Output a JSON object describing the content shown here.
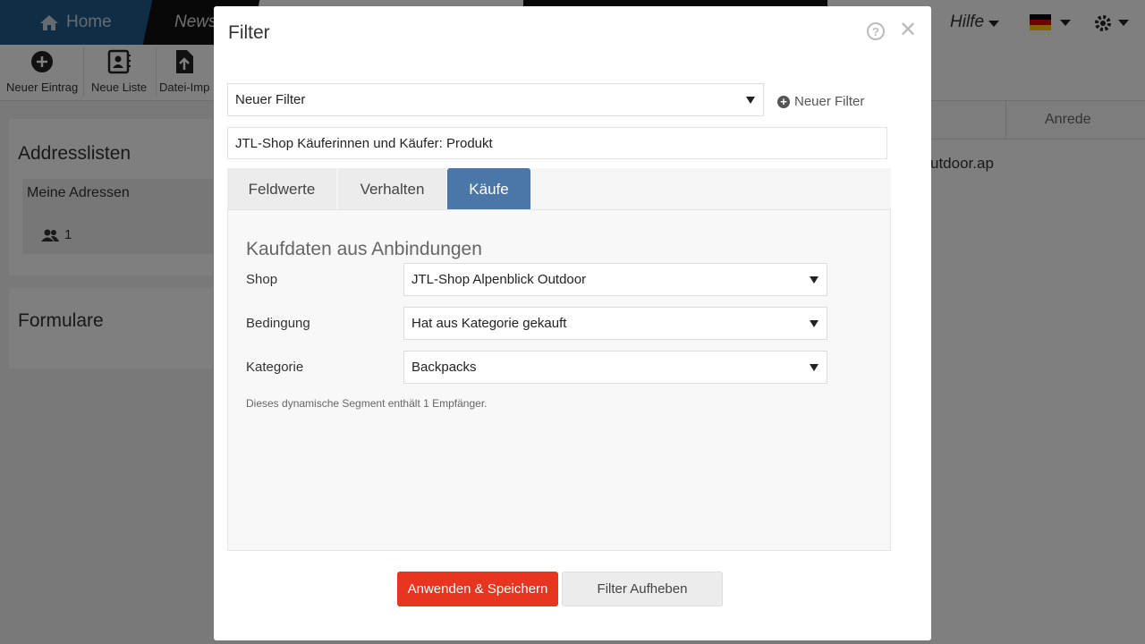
{
  "app": {
    "nav": {
      "home_label": "Home",
      "news_label": "News",
      "help_label": "Hilfe"
    },
    "toolbar": [
      {
        "label": "Neuer Eintrag",
        "icon": "plus-circle-icon"
      },
      {
        "label": "Neue Liste",
        "icon": "address-book-icon"
      },
      {
        "label": "Datei-Imp",
        "icon": "file-upload-icon"
      }
    ],
    "left": {
      "addresslists_title": "Addresslisten",
      "my_addresses_label": "Meine Adressen",
      "my_addresses_count": "1",
      "forms_title": "Formulare"
    },
    "table": {
      "col_salutation": "Anrede",
      "cell_fragment": "utdoor.ap"
    },
    "colors": {
      "nav": "#1f5a8b",
      "accent_tab": "#4a76a8",
      "primary_button": "#e8351f"
    }
  },
  "modal": {
    "title": "Filter",
    "filter_select_value": "Neuer Filter",
    "new_filter_label": "Neuer Filter",
    "filter_name": "JTL-Shop Käuferinnen und Käufer: Produkt",
    "tabs": [
      {
        "label": "Feldwerte",
        "active": false
      },
      {
        "label": "Verhalten",
        "active": false
      },
      {
        "label": "Käufe",
        "active": true
      }
    ],
    "section_title": "Kaufdaten aus Anbindungen",
    "fields": [
      {
        "label": "Shop",
        "value": "JTL-Shop Alpenblick Outdoor"
      },
      {
        "label": "Bedingung",
        "value": "Hat aus Kategorie gekauft"
      },
      {
        "label": "Kategorie",
        "value": "Backpacks"
      }
    ],
    "info_text": "Dieses dynamische Segment enthält 1 Empfänger.",
    "apply_button": "Anwenden & Speichern",
    "clear_button": "Filter Aufheben"
  }
}
